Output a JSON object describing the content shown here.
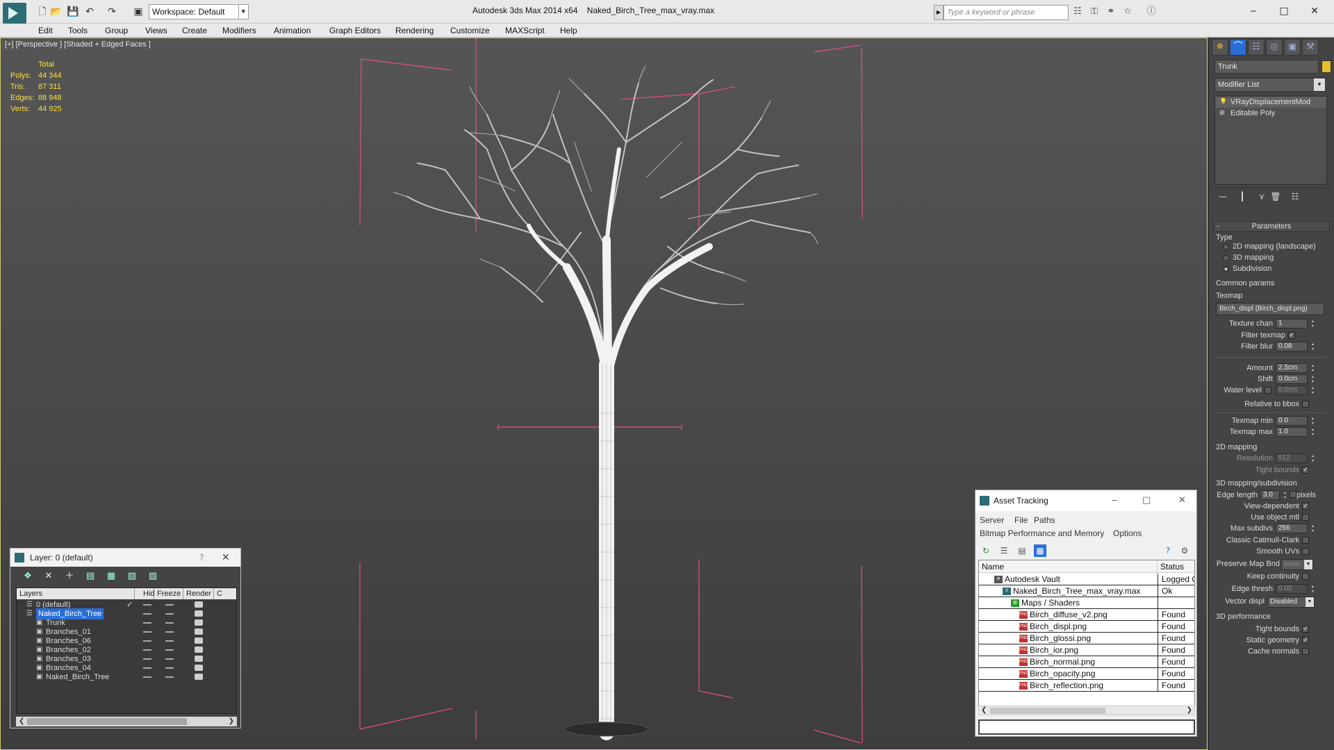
{
  "colors": {
    "accent": "#2a6fd8",
    "stats_text": "#ffdf3a",
    "bbox_lines": "#e0507a",
    "object_color": "#e6c02a"
  },
  "titlebar": {
    "app_title": "Autodesk 3ds Max  2014 x64",
    "file_name": "Naked_Birch_Tree_max_vray.max",
    "workspace": "Workspace: Default",
    "search_placeholder": "Type a keyword or phrase",
    "icons": [
      "new-icon",
      "open-icon",
      "save-icon",
      "undo-icon",
      "redo-icon",
      "project-icon",
      "binoculars-icon",
      "key-icon",
      "link-icon",
      "star-icon",
      "help-icon"
    ]
  },
  "menu": [
    "Edit",
    "Tools",
    "Group",
    "Views",
    "Create",
    "Modifiers",
    "Animation",
    "Graph Editors",
    "Rendering",
    "Customize",
    "MAXScript",
    "Help"
  ],
  "viewport": {
    "label": "[+] [Perspective ] [Shaded + Edged Faces ]",
    "stats": {
      "total_label": "Total",
      "rows": [
        {
          "k": "Polys:",
          "v": "44 344"
        },
        {
          "k": "Tris:",
          "v": "87 311"
        },
        {
          "k": "Edges:",
          "v": "88 948"
        },
        {
          "k": "Verts:",
          "v": "44 925"
        }
      ]
    }
  },
  "cmdpanel": {
    "tabs": [
      "create-tab",
      "modify-tab",
      "hierarchy-tab",
      "motion-tab",
      "display-tab",
      "utilities-tab"
    ],
    "object_name": "Trunk",
    "modifier_list": "Modifier List",
    "stack": [
      "VRayDisplacementMod",
      "Editable Poly"
    ],
    "rollout": "Parameters",
    "type_group": "Type",
    "type_options": [
      "2D mapping (landscape)",
      "3D mapping",
      "Subdivision"
    ],
    "type_selected": 2,
    "common_group": "Common params",
    "texmap_label": "Texmap",
    "texmap_value": "Birch_displ (Birch_displ.png)",
    "texture_chan_label": "Texture chan",
    "texture_chan": "1",
    "filter_texmap_label": "Filter texmap",
    "filter_blur_label": "Filter blur",
    "filter_blur": "0.08",
    "amount_label": "Amount",
    "amount": "2.5cm",
    "shift_label": "Shift",
    "shift": "0.0cm",
    "water_level_label": "Water level",
    "water_level": "0.0cm",
    "relative_bbox_label": "Relative to bbox",
    "texmap_min_label": "Texmap min",
    "texmap_min": "0.0",
    "texmap_max_label": "Texmap max",
    "texmap_max": "1.0",
    "mapping2d_group": "2D mapping",
    "resolution_label": "Resolution",
    "resolution": "512",
    "tight_bounds_label": "Tight bounds",
    "subdiv_group": "3D mapping/subdivision",
    "edge_length_label": "Edge length",
    "edge_length": "3.0",
    "pixels_label": "pixels",
    "view_dependent_label": "View-dependent",
    "use_object_mtl_label": "Use object mtl",
    "max_subdivs_label": "Max subdivs",
    "max_subdivs": "256",
    "classic_catmull_label": "Classic Catmull-Clark",
    "smooth_uvs_label": "Smooth UVs",
    "preserve_map_label": "Preserve Map Bnd",
    "preserve_map_value": "Interr",
    "keep_continuity_label": "Keep continuity",
    "edge_thresh_label": "Edge thresh",
    "edge_thresh": "0.05",
    "vector_displ_label": "Vector displ",
    "vector_displ": "Disabled",
    "perf_group": "3D performance",
    "tight_bounds2_label": "Tight bounds",
    "static_geometry_label": "Static geometry",
    "cache_normals_label": "Cache normals"
  },
  "layer_dialog": {
    "title": "Layer: 0 (default)",
    "help": "?",
    "columns": [
      "Layers",
      "Hide",
      "Freeze",
      "Render",
      "C"
    ],
    "rows": [
      {
        "name": "0 (default)",
        "indent": 0,
        "check": "✓"
      },
      {
        "name": "Naked_Birch_Tree",
        "indent": 0,
        "selected": true,
        "check": ""
      },
      {
        "name": "Trunk",
        "indent": 1,
        "check": ""
      },
      {
        "name": "Branches_01",
        "indent": 1,
        "check": ""
      },
      {
        "name": "Branches_06",
        "indent": 1,
        "check": ""
      },
      {
        "name": "Branches_02",
        "indent": 1,
        "check": ""
      },
      {
        "name": "Branches_03",
        "indent": 1,
        "check": ""
      },
      {
        "name": "Branches_04",
        "indent": 1,
        "check": ""
      },
      {
        "name": "Naked_Birch_Tree",
        "indent": 1,
        "check": ""
      }
    ]
  },
  "asset_dialog": {
    "title": "Asset Tracking",
    "menu1": [
      "Server",
      "File",
      "Paths"
    ],
    "menu2": [
      "Bitmap Performance and Memory",
      "Options"
    ],
    "columns": [
      "Name",
      "Status"
    ],
    "rows": [
      {
        "name": "Autodesk Vault",
        "status": "Logged O",
        "indent": 0,
        "icon": "vault"
      },
      {
        "name": "Naked_Birch_Tree_max_vray.max",
        "status": "Ok",
        "indent": 1,
        "icon": "max"
      },
      {
        "name": "Maps / Shaders",
        "status": "",
        "indent": 2,
        "icon": "maps"
      },
      {
        "name": "Birch_diffuse_v2.png",
        "status": "Found",
        "indent": 3,
        "icon": "png"
      },
      {
        "name": "Birch_displ.png",
        "status": "Found",
        "indent": 3,
        "icon": "png"
      },
      {
        "name": "Birch_glossi.png",
        "status": "Found",
        "indent": 3,
        "icon": "png"
      },
      {
        "name": "Birch_ior.png",
        "status": "Found",
        "indent": 3,
        "icon": "png"
      },
      {
        "name": "Birch_normal.png",
        "status": "Found",
        "indent": 3,
        "icon": "png"
      },
      {
        "name": "Birch_opacity.png",
        "status": "Found",
        "indent": 3,
        "icon": "png"
      },
      {
        "name": "Birch_reflection.png",
        "status": "Found",
        "indent": 3,
        "icon": "png"
      }
    ]
  }
}
